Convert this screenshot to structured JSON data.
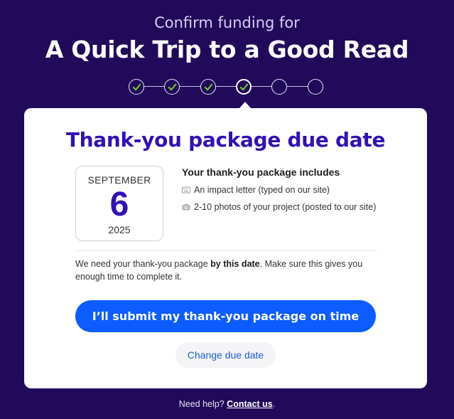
{
  "header": {
    "subtitle": "Confirm funding for",
    "title": "A Quick Trip to a Good Read"
  },
  "progress": {
    "total_steps": 6,
    "completed_steps": 4,
    "current_step": 4
  },
  "card": {
    "title": "Thank-you package due date",
    "due_date": {
      "month": "SEPTEMBER",
      "day": "6",
      "year": "2025"
    },
    "includes": {
      "title": "Your thank-you package includes",
      "items": [
        {
          "icon": "keyboard-icon",
          "text": "An impact letter (typed on our site)"
        },
        {
          "icon": "camera-icon",
          "text": "2-10 photos of your project (posted to our site)"
        }
      ]
    },
    "note": {
      "before": "We need your thank-you package ",
      "bold": "by this date",
      "after": ". Make sure this gives you enough time to complete it."
    },
    "primary_button": "I’ll submit my thank-you package on time",
    "secondary_button": "Change due date"
  },
  "footer": {
    "text": "Need help? ",
    "link": "Contact us",
    "after": "."
  },
  "colors": {
    "background": "#200a59",
    "accent_purple": "#3210b5",
    "primary_blue": "#0c5cff",
    "check_green": "#6fbf2a"
  }
}
